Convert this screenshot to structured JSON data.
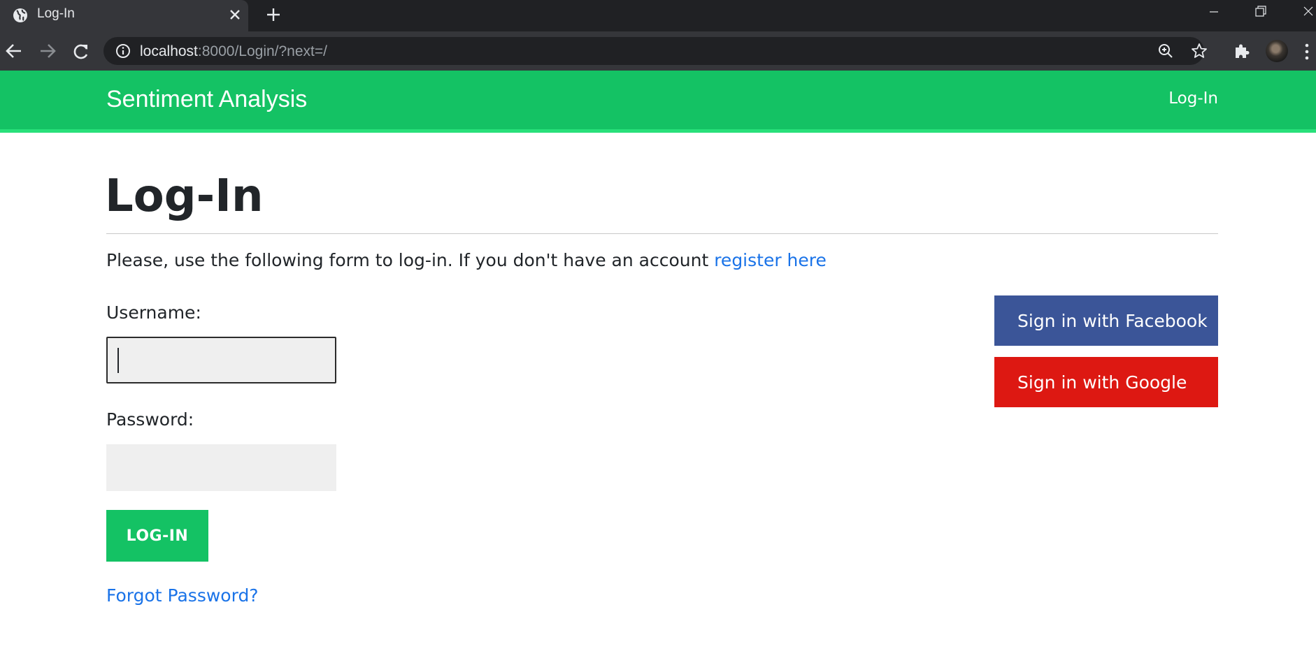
{
  "browser": {
    "tab_title": "Log-In",
    "url_host": "localhost",
    "url_rest": ":8000/Login/?next=/"
  },
  "navbar": {
    "brand": "Sentiment Analysis",
    "login_link": "Log-In",
    "color": "#14c264"
  },
  "page": {
    "title": "Log-In",
    "intro_text": "Please, use the following form to log-in. If you don't have an account ",
    "register_link": "register here",
    "username_label": "Username:",
    "username_value": "",
    "password_label": "Password:",
    "password_value": "",
    "login_button": "LOG-IN",
    "forgot_link": "Forgot Password?"
  },
  "social": {
    "facebook_label": "Sign in with Facebook",
    "facebook_color": "#3b5598",
    "google_label": "Sign in with Google",
    "google_color": "#dd1812"
  }
}
